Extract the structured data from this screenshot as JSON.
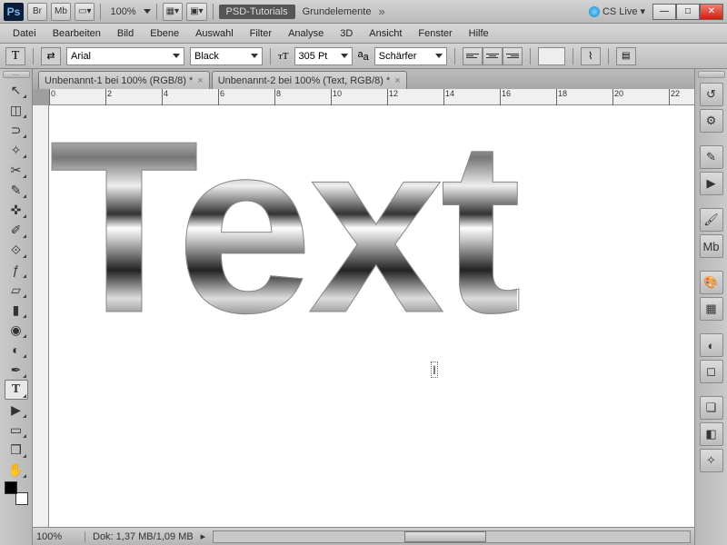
{
  "topbar": {
    "br": "Br",
    "mb": "Mb",
    "zoom": "100%",
    "workspace": "PSD-Tutorials",
    "workspace2": "Grundelemente",
    "cslive": "CS Live"
  },
  "menu": [
    "Datei",
    "Bearbeiten",
    "Bild",
    "Ebene",
    "Auswahl",
    "Filter",
    "Analyse",
    "3D",
    "Ansicht",
    "Fenster",
    "Hilfe"
  ],
  "options": {
    "toolglyph": "T",
    "font": "Arial",
    "weight": "Black",
    "size": "305 Pt",
    "aa": "Schärfer"
  },
  "tabs": [
    "Unbenannt-1 bei 100% (RGB/8) *",
    "Unbenannt-2 bei 100% (Text, RGB/8) *"
  ],
  "hruler": [
    "0",
    "2",
    "4",
    "6",
    "8",
    "10",
    "12",
    "14",
    "16",
    "18",
    "20",
    "22"
  ],
  "canvas_text": "Text",
  "status": {
    "zoom": "100%",
    "doc": "Dok: 1,37 MB/1,09 MB"
  }
}
